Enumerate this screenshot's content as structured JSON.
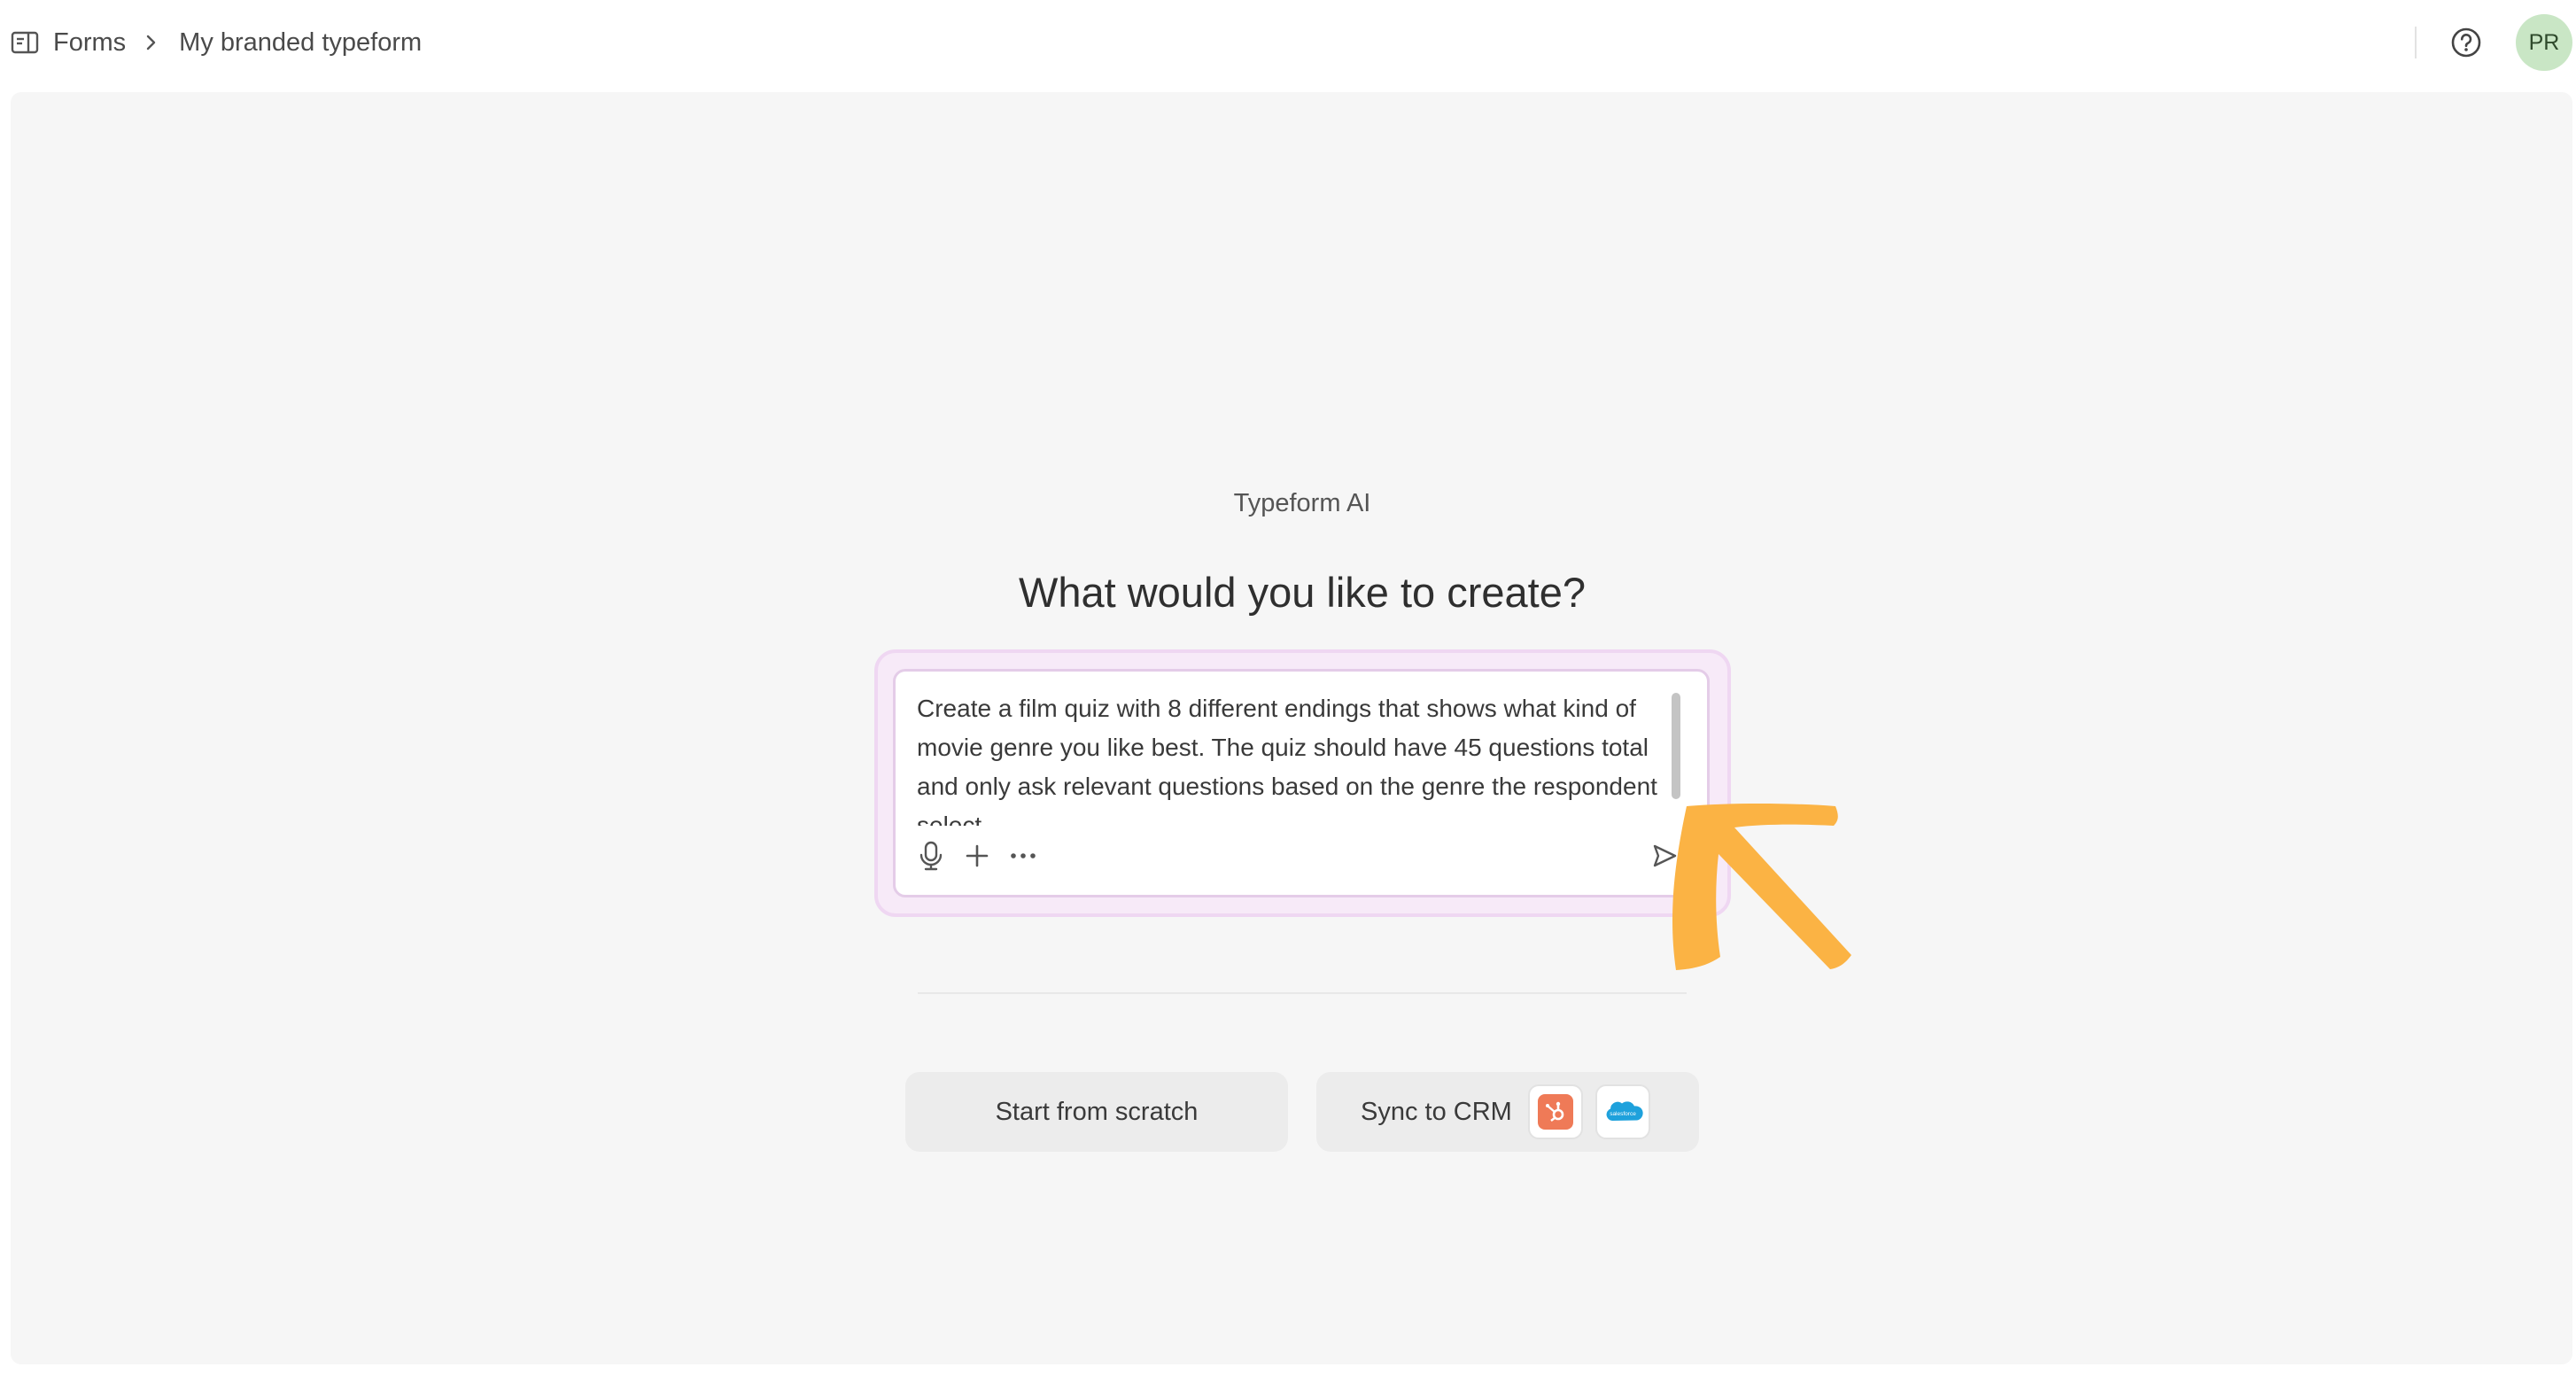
{
  "breadcrumb": {
    "root_label": "Forms",
    "current_label": "My branded typeform"
  },
  "header": {
    "avatar_initials": "PR"
  },
  "main": {
    "eyebrow": "Typeform AI",
    "headline": "What would you like to create?"
  },
  "prompt": {
    "value": "Create a film quiz with 8 different endings that shows what kind of movie genre you like best. The quiz should have 45 questions total and only ask relevant questions based on the genre the respondent select",
    "tools": [
      "microphone-icon",
      "plus-icon",
      "more-icon"
    ],
    "send_icon": "send-icon"
  },
  "actions": {
    "start_from_scratch": "Start from scratch",
    "sync_to_crm": "Sync to CRM",
    "crm_logos": [
      "hubspot-logo",
      "salesforce-logo"
    ],
    "salesforce_wordmark": "salesforce"
  },
  "colors": {
    "canvas_bg": "#f6f6f6",
    "prompt_glow": "#f7eaf8",
    "prompt_border": "#e4cce8",
    "avatar_bg": "#c9e6c5",
    "arrow": "#fbb344",
    "hubspot": "#ef7a57",
    "salesforce": "#1ea1dc"
  }
}
